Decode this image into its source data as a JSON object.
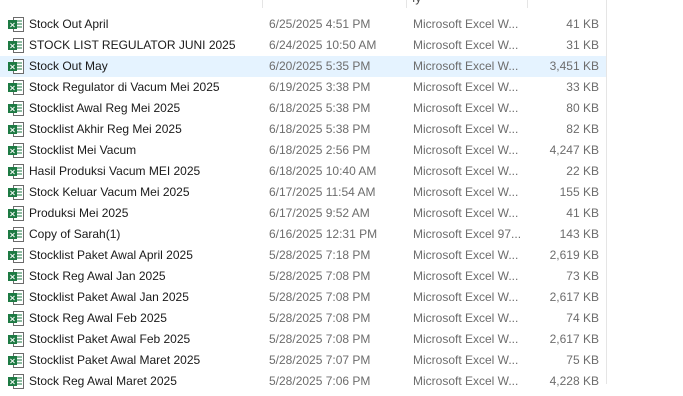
{
  "header": {
    "type_tail": "ıy"
  },
  "colors": {
    "excel_green": "#1d7a43",
    "selection": "#e5f3ff"
  },
  "files": [
    {
      "name": "Stock Out April",
      "date": "6/25/2025 4:51 PM",
      "type": "Microsoft Excel W...",
      "size": "41 KB",
      "icon": "excel-file-icon"
    },
    {
      "name": "STOCK LIST REGULATOR JUNI 2025",
      "date": "6/24/2025 10:50 AM",
      "type": "Microsoft Excel W...",
      "size": "31 KB",
      "icon": "excel-file-icon"
    },
    {
      "name": "Stock Out May",
      "date": "6/20/2025 5:35 PM",
      "type": "Microsoft Excel W...",
      "size": "3,451 KB",
      "icon": "excel-file-icon",
      "selected": true
    },
    {
      "name": "Stock Regulator di Vacum Mei 2025",
      "date": "6/19/2025 3:38 PM",
      "type": "Microsoft Excel W...",
      "size": "33 KB",
      "icon": "excel-file-icon"
    },
    {
      "name": "Stocklist Awal Reg Mei 2025",
      "date": "6/18/2025 5:38 PM",
      "type": "Microsoft Excel W...",
      "size": "80 KB",
      "icon": "excel-file-icon"
    },
    {
      "name": "Stocklist Akhir Reg Mei 2025",
      "date": "6/18/2025 5:38 PM",
      "type": "Microsoft Excel W...",
      "size": "82 KB",
      "icon": "excel-file-icon"
    },
    {
      "name": "Stocklist Mei Vacum",
      "date": "6/18/2025 2:56 PM",
      "type": "Microsoft Excel W...",
      "size": "4,247 KB",
      "icon": "excel-file-icon"
    },
    {
      "name": "Hasil Produksi Vacum MEI 2025",
      "date": "6/18/2025 10:40 AM",
      "type": "Microsoft Excel W...",
      "size": "22 KB",
      "icon": "excel-file-icon"
    },
    {
      "name": "Stock Keluar Vacum Mei 2025",
      "date": "6/17/2025 11:54 AM",
      "type": "Microsoft Excel W...",
      "size": "155 KB",
      "icon": "excel-file-icon"
    },
    {
      "name": "Produksi Mei 2025",
      "date": "6/17/2025 9:52 AM",
      "type": "Microsoft Excel W...",
      "size": "41 KB",
      "icon": "excel-file-icon"
    },
    {
      "name": "Copy of Sarah(1)",
      "date": "6/16/2025 12:31 PM",
      "type": "Microsoft Excel 97...",
      "size": "143 KB",
      "icon": "excel-97-file-icon"
    },
    {
      "name": "Stocklist Paket Awal April 2025",
      "date": "5/28/2025 7:18 PM",
      "type": "Microsoft Excel W...",
      "size": "2,619 KB",
      "icon": "excel-file-icon"
    },
    {
      "name": "Stock Reg Awal Jan 2025",
      "date": "5/28/2025 7:08 PM",
      "type": "Microsoft Excel W...",
      "size": "73 KB",
      "icon": "excel-file-icon"
    },
    {
      "name": "Stocklist Paket Awal Jan 2025",
      "date": "5/28/2025 7:08 PM",
      "type": "Microsoft Excel W...",
      "size": "2,617 KB",
      "icon": "excel-file-icon"
    },
    {
      "name": "Stock Reg Awal Feb 2025",
      "date": "5/28/2025 7:08 PM",
      "type": "Microsoft Excel W...",
      "size": "74 KB",
      "icon": "excel-file-icon"
    },
    {
      "name": "Stocklist Paket Awal Feb 2025",
      "date": "5/28/2025 7:08 PM",
      "type": "Microsoft Excel W...",
      "size": "2,617 KB",
      "icon": "excel-file-icon"
    },
    {
      "name": "Stocklist Paket Awal Maret 2025",
      "date": "5/28/2025 7:07 PM",
      "type": "Microsoft Excel W...",
      "size": "75 KB",
      "icon": "excel-file-icon"
    },
    {
      "name": "Stock Reg Awal Maret 2025",
      "date": "5/28/2025 7:06 PM",
      "type": "Microsoft Excel W...",
      "size": "4,228 KB",
      "icon": "excel-file-icon"
    }
  ]
}
